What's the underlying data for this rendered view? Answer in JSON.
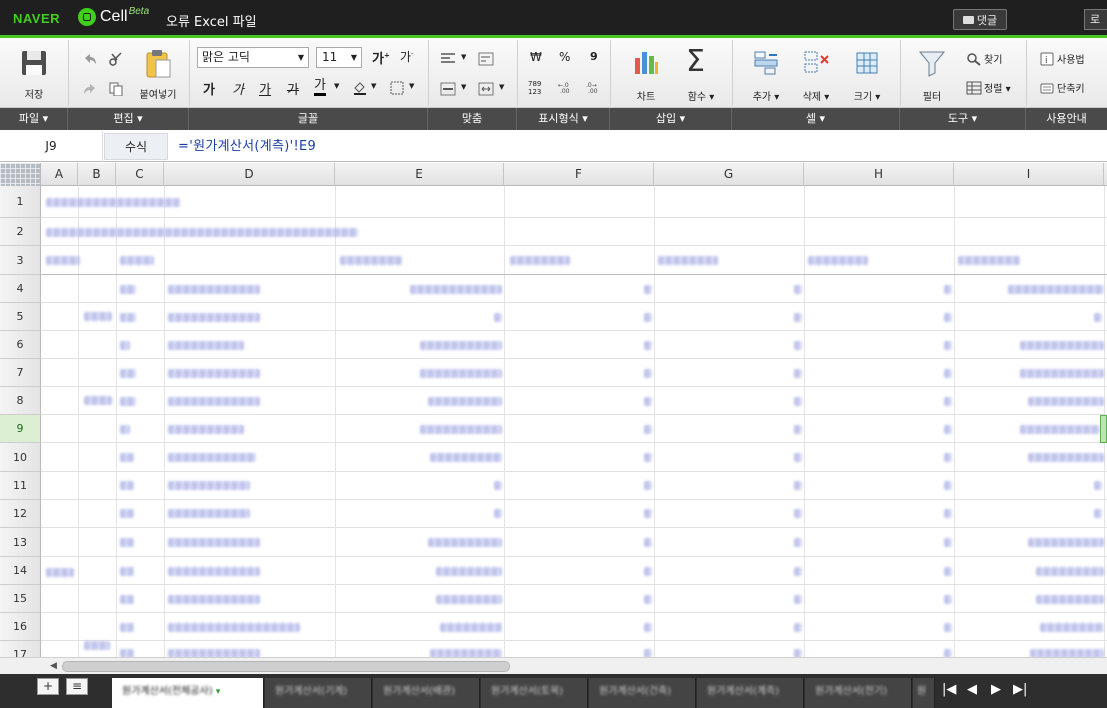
{
  "topbar": {
    "brand": "NAVER",
    "product": "Cell",
    "product_tag": "Beta",
    "file_title": "오류 Excel 파일",
    "comment_label": "댓글",
    "login_label": "로"
  },
  "ribbon": {
    "save": "저장",
    "paste": "붙여넣기",
    "font_name": "맑은 고딕",
    "font_size": "11",
    "bold": "가",
    "italic": "가",
    "underline": "가",
    "strike": "가",
    "font_color": "가",
    "currency": "₩",
    "percent": "%",
    "comma": "9",
    "number_fmt": "789\n123",
    "chart": "차트",
    "function": "함수",
    "insert": "추가",
    "delete": "삭제",
    "size": "크기",
    "filter": "필터",
    "find": "찾기",
    "sort": "정렬",
    "help": "사용법",
    "shortcut": "단축키"
  },
  "groups": [
    "파일",
    "편집",
    "글꼴",
    "맞춤",
    "표시형식",
    "삽입",
    "셀",
    "도구",
    "사용안내"
  ],
  "formula_bar": {
    "cell_ref": "J9",
    "fx_label": "수식",
    "formula": "='원가계산서(계측)'!E9"
  },
  "columns": [
    "A",
    "B",
    "C",
    "D",
    "E",
    "F",
    "G",
    "H",
    "I"
  ],
  "rows": [
    "1",
    "2",
    "3",
    "4",
    "5",
    "6",
    "7",
    "8",
    "9",
    "10",
    "11",
    "12",
    "13",
    "14",
    "15",
    "16",
    "17"
  ],
  "selected_row": "9",
  "sheet_tabs": {
    "add": "+",
    "list": "≡",
    "tabs": [
      "원가계산서(전체공사)",
      "원가계산서(기계)",
      "원가계산서(배관)",
      "원가계산서(토목)",
      "원가계산서(건축)",
      "원가계산서(계측)",
      "원가계산서(전기)",
      "원"
    ],
    "nav": [
      "|◀",
      "◀",
      "▶",
      "▶|"
    ]
  }
}
